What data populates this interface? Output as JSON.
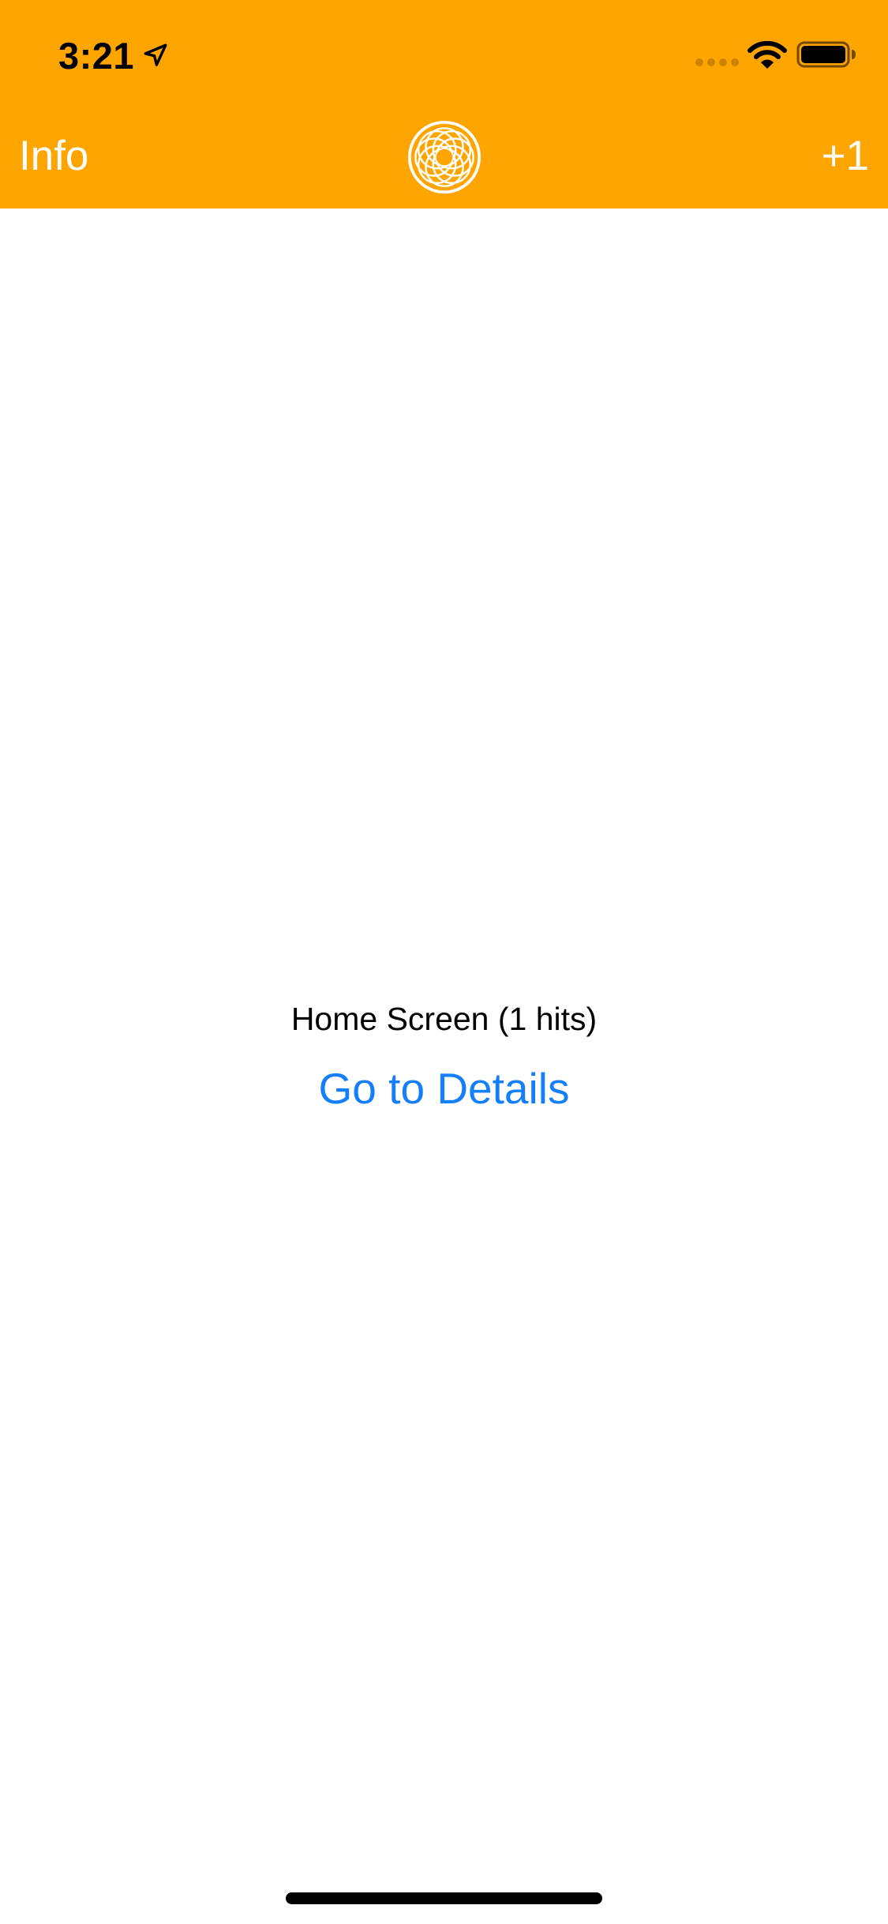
{
  "status_bar": {
    "time": "3:21",
    "icons": [
      "location-arrow-icon",
      "cellular-signal-icon",
      "wifi-icon",
      "battery-icon"
    ]
  },
  "nav": {
    "left_label": "Info",
    "right_label": "+1",
    "logo_icon": "circular-rosette-logo-icon"
  },
  "main": {
    "title": "Home Screen (1 hits)",
    "link_label": "Go to Details"
  },
  "colors": {
    "header_bg": "#FFA500",
    "link": "#147EFB",
    "nav_text": "#FFFFFF",
    "body_text": "#000000"
  }
}
